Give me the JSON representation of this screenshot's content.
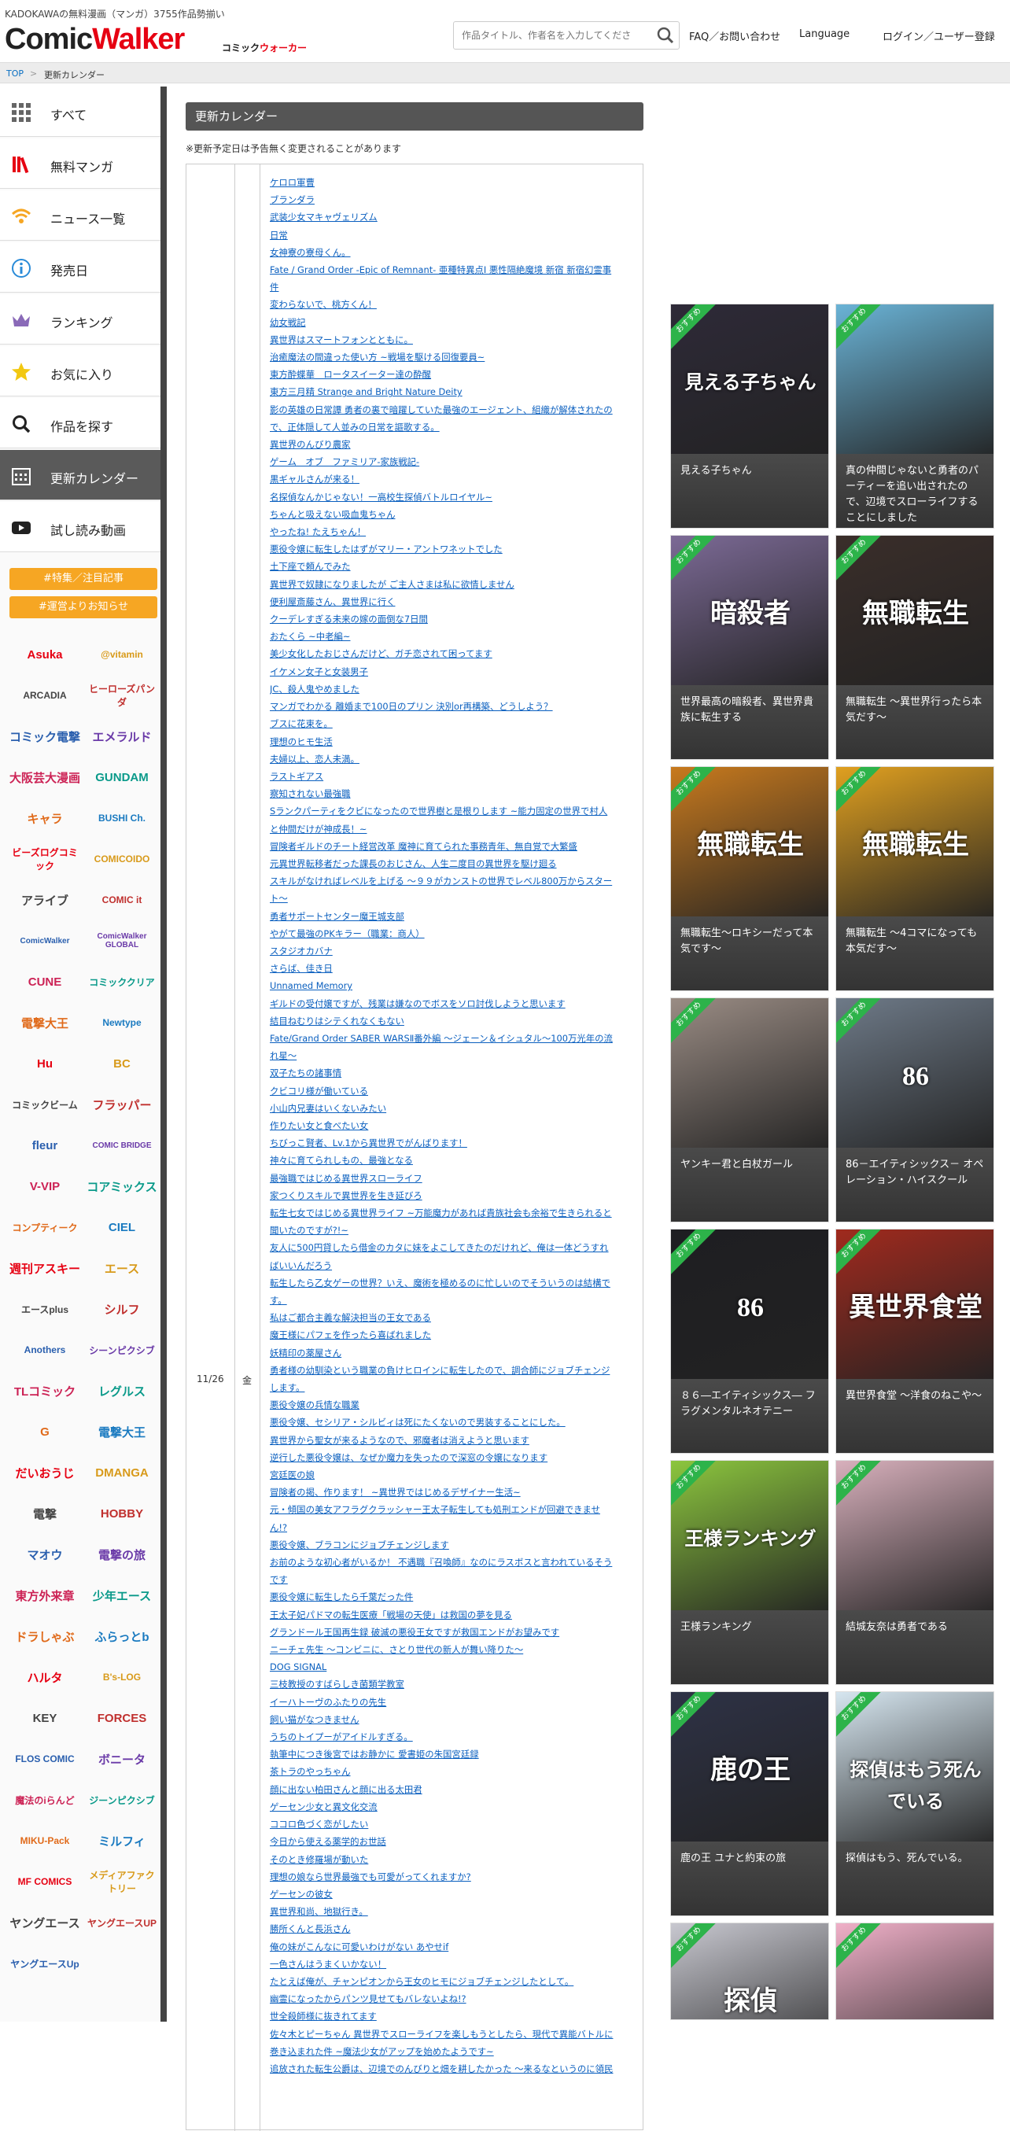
{
  "header": {
    "tagline": "KADOKAWAの無料漫画（マンガ）3755作品勢揃い",
    "logo_comic": "Comic",
    "logo_walker": "Walker",
    "logo_sub_black": "コミック",
    "logo_sub_red": "ウォーカー",
    "search_placeholder": "作品タイトル、作者名を入力してくださ",
    "faq": "FAQ／お問い合わせ",
    "language": "Language",
    "login": "ログイン／ユーザー登録"
  },
  "breadcrumb": {
    "top": "TOP",
    "sep": ">",
    "current": "更新カレンダー"
  },
  "sidebar": {
    "items": [
      {
        "label": "すべて",
        "icon": "grid-icon"
      },
      {
        "label": "無料マンガ",
        "icon": "books-icon"
      },
      {
        "label": "ニュース一覧",
        "icon": "wifi-icon"
      },
      {
        "label": "発売日",
        "icon": "info-icon"
      },
      {
        "label": "ランキング",
        "icon": "crown-icon"
      },
      {
        "label": "お気に入り",
        "icon": "star-icon"
      },
      {
        "label": "作品を探す",
        "icon": "search-icon"
      },
      {
        "label": "更新カレンダー",
        "icon": "calendar-icon"
      },
      {
        "label": "試し読み動画",
        "icon": "play-icon"
      }
    ],
    "notices": [
      "#特集／注目記事",
      "#運営よりお知らせ"
    ],
    "publishers": [
      {
        "left": "Asuka",
        "right": "@vitamin"
      },
      {
        "left": "ARCADIA",
        "right": "ヒーローズパンダ"
      },
      {
        "left": "コミック電撃",
        "right": "エメラルド"
      },
      {
        "left": "大阪芸大漫画",
        "right": "GUNDAM"
      },
      {
        "left": "キャラ",
        "right": "BUSHI Ch."
      },
      {
        "left": "ビーズログコミック",
        "right": "COMICOIDO"
      },
      {
        "left": "アライブ",
        "right": "COMIC it"
      },
      {
        "left": "ComicWalker",
        "right": "ComicWalker GLOBAL"
      },
      {
        "left": "CUNE",
        "right": "コミッククリア"
      },
      {
        "left": "電撃大王",
        "right": "Newtype"
      },
      {
        "left": "Hu",
        "right": "BC"
      },
      {
        "left": "コミックビーム",
        "right": "フラッパー"
      },
      {
        "left": "fleur",
        "right": "COMIC BRIDGE"
      },
      {
        "left": "V-VIP",
        "right": "コアミックス"
      },
      {
        "left": "コンプティーク",
        "right": "CIEL"
      },
      {
        "left": "週刊アスキー",
        "right": "エース"
      },
      {
        "left": "エースplus",
        "right": "シルフ"
      },
      {
        "left": "Anothers",
        "right": "シーンピクシブ"
      },
      {
        "left": "TLコミック",
        "right": "レグルス"
      },
      {
        "left": "G",
        "right": "電撃大王"
      },
      {
        "left": "だいおうじ",
        "right": "DMANGA"
      },
      {
        "left": "電撃",
        "right": "HOBBY"
      },
      {
        "left": "マオウ",
        "right": "電撃の旅"
      },
      {
        "left": "東方外来章",
        "right": "少年エース"
      },
      {
        "left": "ドラしゃぶ",
        "right": "ふらっとb"
      },
      {
        "left": "ハルタ",
        "right": "B's-LOG"
      },
      {
        "left": "KEY",
        "right": "FORCES"
      },
      {
        "left": "FLOS COMIC",
        "right": "ボニータ"
      },
      {
        "left": "魔法のiらんど",
        "right": "ジーンピクシブ"
      },
      {
        "left": "MIKU-Pack",
        "right": "ミルフィ"
      },
      {
        "left": "MF COMICS",
        "right": "メディアファクトリー"
      },
      {
        "left": "ヤングエース",
        "right": "ヤングエースUP"
      },
      {
        "left": "ヤングエースUp",
        "right": ""
      }
    ]
  },
  "calendar": {
    "title": "更新カレンダー",
    "note": "※更新予定日は予告無く変更されることがあります",
    "date": "11/26",
    "weekday": "金",
    "titles": [
      "ケロロ軍曹",
      "ブランダラ",
      "武装少女マキャヴェリズム",
      "日常",
      "女神寮の寮母くん。",
      "Fate / Grand Order -Epic of Remnant- 亜種特異点Ⅰ 悪性隔絶魔境 新宿 新宿幻霊事",
      "件",
      "変わらないで、桃方くん！",
      "幼女戦記",
      "異世界はスマートフォンとともに。",
      "治癒魔法の間違った使い方 ~戦場を駆ける回復要員~",
      "東方酔蝶華　ロータスイーター達の酔醒",
      "東方三月精 Strange and Bright Nature Deity",
      "影の英雄の日常譚 勇者の裏で暗躍していた最強のエージェント、組織が解体されたの",
      "で、正体隠して人並みの日常を謳歌する。",
      "異世界のんびり農家",
      "ゲーム　オブ　ファミリア-家族戦記-",
      "黒ギャルさんが来る！",
      "名探偵なんかじゃない！一高校生探偵バトルロイヤル~",
      "ちゃんと吸えない吸血鬼ちゃん",
      "やったね! たえちゃん！",
      "悪役令嬢に転生したはずがマリー・アントワネットでした",
      "土下座で頼んでみた",
      "異世界で奴隷になりましたが ご主人さまは私に欲情しません",
      "便利屋斎藤さん、異世界に行く",
      "クーデレすぎる未来の嫁の面倒な7日間",
      "おたくら ~中老編~",
      "美少女化したおじさんだけど、ガチ恋されて困ってます",
      "イケメン女子と女装男子",
      "JC、殺人鬼やめました",
      "マンガでわかる 離婚まで100日のプリン 決別or再構築、どうしよう？",
      "ブスに花束を。",
      "理想のヒモ生活",
      "夫婦以上、恋人未満。",
      "ラストギアス",
      "察知されない最強職",
      "Sランクパーティをクビになったので世界樹と是根りします ~能力固定の世界で村人",
      "と仲間だけが神成長！~",
      "冒険者ギルドのチート経営改革 魔神に育てられた事務青年、無自覚で大繁盛",
      "元異世界転移者だった課長のおじさん、人生二度目の異世界を駆け廻る",
      "スキルがなければレベルを上げる ～９９がカンストの世界でレベル800万からスター",
      "ト～",
      "勇者サポートセンター魔王城支部",
      "やがて最強のPKキラー（職業：商人）",
      "スタジオカバナ",
      "さらば、佳き日",
      "Unnamed Memory",
      "ギルドの受付嬢ですが、残業は嫌なのでボスをソロ討伐しようと思います",
      "結目ねむりはシテくれなくもない",
      "Fate/Grand Order SABER WARSⅡ番外編 ～ジェーン＆イシュタル～100万光年の流",
      "れ星～",
      "双子たちの諸事情",
      "クビコリ様が働いている",
      "小山内兄妻はいくないみたい",
      "作りたい女と食べたい女",
      "ちびっこ賢者、Lv.1から異世界でがんばります！",
      "神々に育てられしもの、最強となる",
      "最強職ではじめる異世界スローライフ",
      "家つくりスキルで異世界を生き延びろ",
      "転生七女ではじめる異世界ライフ ~万能魔力があれば貴族社会も余裕で生きられると",
      "聞いたのですが?!~",
      "友人に500円貸したら借金のカタに妹をよこしてきたのだけれど、俺は一体どうすれ",
      "ばいいんだろう",
      "転生したら乙女ゲーの世界？いえ、魔術を極めるのに忙しいのでそういうのは結構で",
      "す。",
      "私はご都合主義な解決担当の王女である",
      "魔王様にパフェを作ったら喜ばれました",
      "妖精印の薬屋さん",
      "勇者様の幼馴染という職業の負けヒロインに転生したので、調合師にジョブチェンジ",
      "します。",
      "悪役令嬢の兵情な職業",
      "悪役令嬢、セシリア・シルビィは死にたくないので男装することにした。",
      "異世界から聖女が来るようなので、邪魔者は消えようと思います",
      "逆行した悪役令嬢は、なぜか魔力を失ったので深窓の令嬢になります",
      "宮廷医の娘",
      "冒険者の掲、作ります！ ~異世界ではじめるデザイナー生活~",
      "元・傾国の美女アフラグクラッシャー王太子転生しても処刑エンドが回避できませ",
      "ん!?",
      "悪役令嬢、ブラコンにジョブチェンジします",
      "お前のような初心者がいるか！ 不遇職『召喚師』なのにラスボスと言われているそう",
      "です",
      "悪役令嬢に転生したら千葉だった件",
      "王太子妃パドマの転生医療「戦場の天使」は救国の夢を見る",
      "グランドール王国再生録 破滅の悪役王女ですが救国エンドがお望みです",
      "ニーチェ先生 ～コンビニに、さとり世代の新人が舞い降りた～",
      "DOG SIGNAL",
      "三枝教授のすばらしき菌類学教室",
      "イーハトーヴのふたりの先生",
      "飼い猫がなつきません",
      "うちのトイプーがアイドルすぎる。",
      "執筆中につき後宮ではお静かに 愛書姫の朱国宮廷録",
      "茶トラのやっちゃん",
      "顔に出ない柏田さんと顔に出る太田君",
      "ゲーセン少女と異文化交流",
      "ココロ色づく恋がしたい",
      "今日から使える薬学的お世話",
      "そのとき修羅場が動いた",
      "理想の娘なら世界最強でも可愛がってくれますか?",
      "ゲーセンの彼女",
      "異世界和尚、地獄行き。",
      "勝所くんと長浜さん",
      "俺の妹がこんなに可愛いわけがない あやせif",
      "一色さんはうまくいかない！",
      "たとえば俺が、チャンピオンから王女のヒモにジョブチェンジしたとして。",
      "幽霊になったからパンツ見せてもバレないよね!?",
      "世全殺師様に抜きれてます",
      "佐々木とピーちゃん 異世界でスローライフを楽しもうとしたら、現代で異能バトルに",
      "巻き込まれた件 ~魔法少女がアップを始めたようです~",
      "追放された転生公爵は、辺境でのんびりと畑を耕したかった ～来るなというのに領民"
    ]
  },
  "recommend": {
    "badge": "おすすめ",
    "cards": [
      {
        "title": "見える子ちゃん",
        "cover": "見える子ちゃん",
        "color": "#2e2a38"
      },
      {
        "title": "真の仲間じゃないと勇者のパーティーを追い出されたので、辺境でスローライフすることにしました",
        "cover": "",
        "color": "#6ab3d6"
      },
      {
        "title": "世界最高の暗殺者、異世界貴族に転生する",
        "cover": "暗殺者",
        "color": "#7c6a96"
      },
      {
        "title": "無職転生 ～異世界行ったら本気だす～",
        "cover": "無職転生",
        "color": "#3a2e2a"
      },
      {
        "title": "無職転生～ロキシーだって本気です～",
        "cover": "無職転生",
        "color": "#c87a1e"
      },
      {
        "title": "無職転生 ～4コマになっても本気だす～",
        "cover": "無職転生",
        "color": "#e0a020"
      },
      {
        "title": "ヤンキー君と白杖ガール",
        "cover": "",
        "color": "#9a8c84"
      },
      {
        "title": "86－エイティシックス－ オペレーション・ハイスクール",
        "cover": "86",
        "color": "#6e7a88"
      },
      {
        "title": "８６―エイティシックス― フラグメンタルネオテニー",
        "cover": "86",
        "color": "#1e1e22"
      },
      {
        "title": "異世界食堂 ～洋食のねこや～",
        "cover": "異世界食堂",
        "color": "#a02a1e"
      },
      {
        "title": "王様ランキング",
        "cover": "王様ランキング",
        "color": "#8cc63e"
      },
      {
        "title": "結城友奈は勇者である",
        "cover": "",
        "color": "#d8b0bc"
      },
      {
        "title": "鹿の王 ユナと約束の旅",
        "cover": "鹿の王",
        "color": "#2e3246"
      },
      {
        "title": "探偵はもう、死んでいる。",
        "cover": "探偵はもう死んでいる",
        "color": "#d6e6f0"
      },
      {
        "title": "",
        "cover": "探偵",
        "color": "#c8c8d0"
      },
      {
        "title": "",
        "cover": "",
        "color": "#f0b0c8"
      }
    ]
  },
  "colors": {
    "accent": "#e60012",
    "link": "#0a5fbf",
    "badge": "#2db34a",
    "notice": "#f6a623"
  }
}
